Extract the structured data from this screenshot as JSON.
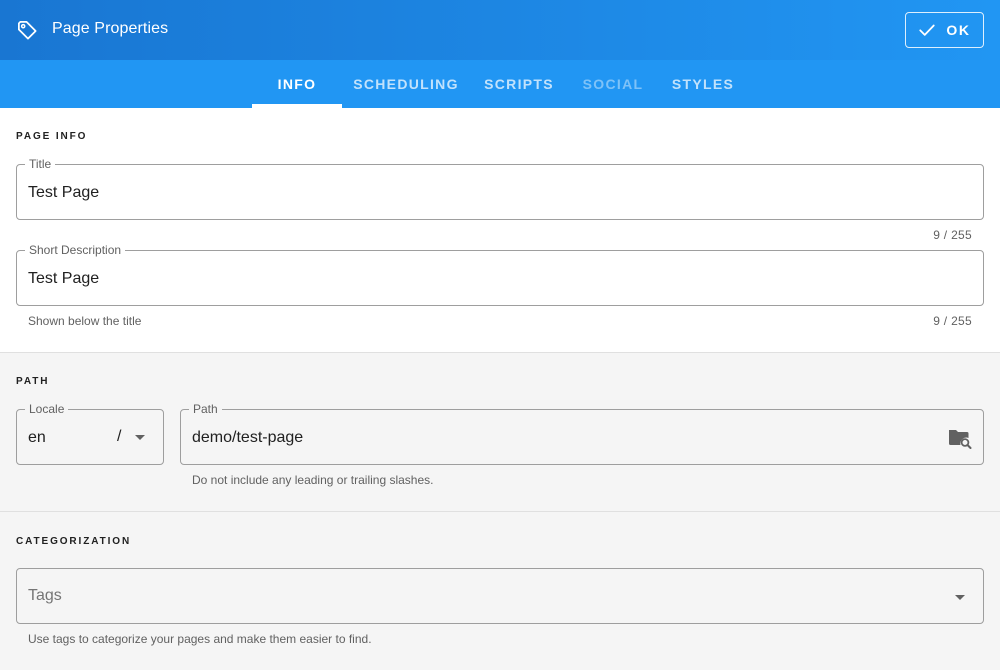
{
  "header": {
    "title": "Page Properties",
    "ok_label": "OK"
  },
  "tabs": [
    {
      "label": "INFO",
      "state": "active"
    },
    {
      "label": "SCHEDULING",
      "state": "normal"
    },
    {
      "label": "SCRIPTS",
      "state": "normal"
    },
    {
      "label": "SOCIAL",
      "state": "disabled"
    },
    {
      "label": "STYLES",
      "state": "normal"
    }
  ],
  "page_info": {
    "heading": "PAGE INFO",
    "title_field": {
      "label": "Title",
      "value": "Test Page",
      "counter": "9 / 255"
    },
    "desc_field": {
      "label": "Short Description",
      "value": "Test Page",
      "hint": "Shown below the title",
      "counter": "9 / 255"
    }
  },
  "path_section": {
    "heading": "PATH",
    "locale": {
      "label": "Locale",
      "value": "en",
      "separator": "/"
    },
    "path": {
      "label": "Path",
      "value": "demo/test-page",
      "hint": "Do not include any leading or trailing slashes."
    }
  },
  "categorization": {
    "heading": "CATEGORIZATION",
    "tags": {
      "placeholder": "Tags",
      "hint": "Use tags to categorize your pages and make them easier to find."
    }
  },
  "icons": {
    "header": "tag-outline-icon",
    "ok": "check-icon",
    "path_browse": "folder-search-icon",
    "dropdown": "chevron-down-icon"
  },
  "colors": {
    "primary": "#1976d2",
    "primary_light": "#2196f3"
  }
}
